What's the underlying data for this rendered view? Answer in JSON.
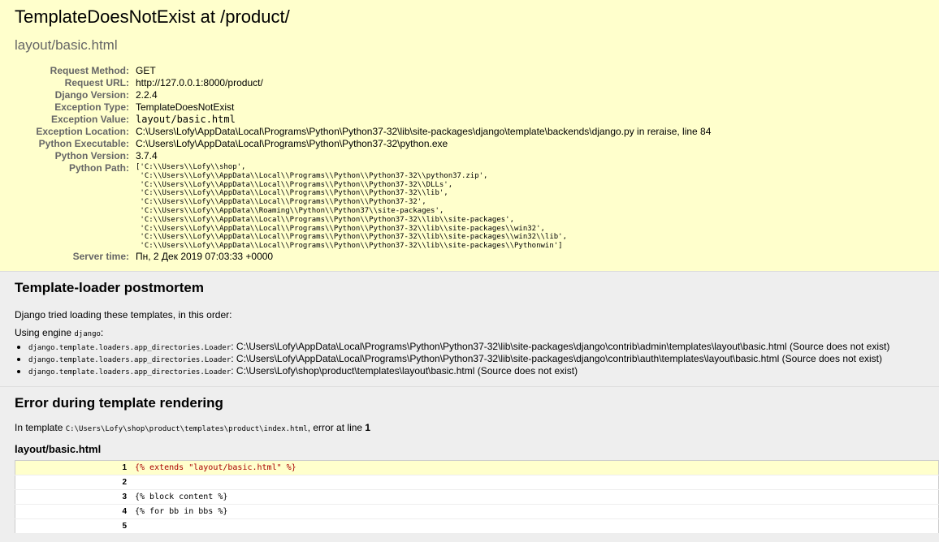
{
  "summary": {
    "title": "TemplateDoesNotExist at /product/",
    "exception_value": "layout/basic.html",
    "meta": [
      {
        "label": "Request Method:",
        "value": "GET"
      },
      {
        "label": "Request URL:",
        "value": "http://127.0.0.1:8000/product/"
      },
      {
        "label": "Django Version:",
        "value": "2.2.4"
      },
      {
        "label": "Exception Type:",
        "value": "TemplateDoesNotExist"
      },
      {
        "label": "Exception Value:",
        "value": "layout/basic.html"
      },
      {
        "label": "Exception Location:",
        "value": "C:\\Users\\Lofy\\AppData\\Local\\Programs\\Python\\Python37-32\\lib\\site-packages\\django\\template\\backends\\django.py in reraise, line 84"
      },
      {
        "label": "Python Executable:",
        "value": "C:\\Users\\Lofy\\AppData\\Local\\Programs\\Python\\Python37-32\\python.exe"
      },
      {
        "label": "Python Version:",
        "value": "3.7.4"
      },
      {
        "label": "Python Path:",
        "value": "['C:\\\\Users\\\\Lofy\\\\shop',\n 'C:\\\\Users\\\\Lofy\\\\AppData\\\\Local\\\\Programs\\\\Python\\\\Python37-32\\\\python37.zip',\n 'C:\\\\Users\\\\Lofy\\\\AppData\\\\Local\\\\Programs\\\\Python\\\\Python37-32\\\\DLLs',\n 'C:\\\\Users\\\\Lofy\\\\AppData\\\\Local\\\\Programs\\\\Python\\\\Python37-32\\\\lib',\n 'C:\\\\Users\\\\Lofy\\\\AppData\\\\Local\\\\Programs\\\\Python\\\\Python37-32',\n 'C:\\\\Users\\\\Lofy\\\\AppData\\\\Roaming\\\\Python\\\\Python37\\\\site-packages',\n 'C:\\\\Users\\\\Lofy\\\\AppData\\\\Local\\\\Programs\\\\Python\\\\Python37-32\\\\lib\\\\site-packages',\n 'C:\\\\Users\\\\Lofy\\\\AppData\\\\Local\\\\Programs\\\\Python\\\\Python37-32\\\\lib\\\\site-packages\\\\win32',\n 'C:\\\\Users\\\\Lofy\\\\AppData\\\\Local\\\\Programs\\\\Python\\\\Python37-32\\\\lib\\\\site-packages\\\\win32\\\\lib',\n 'C:\\\\Users\\\\Lofy\\\\AppData\\\\Local\\\\Programs\\\\Python\\\\Python37-32\\\\lib\\\\site-packages\\\\Pythonwin']"
      },
      {
        "label": "Server time:",
        "value": "Пн, 2 Дек 2019 07:03:33 +0000"
      }
    ]
  },
  "postmortem": {
    "heading": "Template-loader postmortem",
    "intro": "Django tried loading these templates, in this order:",
    "engine_prefix": "Using engine ",
    "engine_name": "django",
    "engine_suffix": ":",
    "loaders": [
      {
        "loader": "django.template.loaders.app_directories.Loader",
        "sep": ": ",
        "path": "C:\\Users\\Lofy\\AppData\\Local\\Programs\\Python\\Python37-32\\lib\\site-packages\\django\\contrib\\admin\\templates\\layout\\basic.html (Source does not exist)"
      },
      {
        "loader": "django.template.loaders.app_directories.Loader",
        "sep": ": ",
        "path": "C:\\Users\\Lofy\\AppData\\Local\\Programs\\Python\\Python37-32\\lib\\site-packages\\django\\contrib\\auth\\templates\\layout\\basic.html (Source does not exist)"
      },
      {
        "loader": "django.template.loaders.app_directories.Loader",
        "sep": ": ",
        "path": "C:\\Users\\Lofy\\shop\\product\\templates\\layout\\basic.html (Source does not exist)"
      }
    ]
  },
  "template_error": {
    "heading": "Error during template rendering",
    "in_template_prefix": "In template ",
    "template_path": "C:\\Users\\Lofy\\shop\\product\\templates\\product\\index.html",
    "error_at_text": ", error at line ",
    "error_line": "1",
    "source_title": "layout/basic.html",
    "source_lines": [
      {
        "num": "1",
        "code": "{% extends \"layout/basic.html\" %}"
      },
      {
        "num": "2",
        "code": ""
      },
      {
        "num": "3",
        "code": "{% block content %}"
      },
      {
        "num": "4",
        "code": "{% for bb in bbs %}"
      },
      {
        "num": "5",
        "code": ""
      }
    ]
  }
}
